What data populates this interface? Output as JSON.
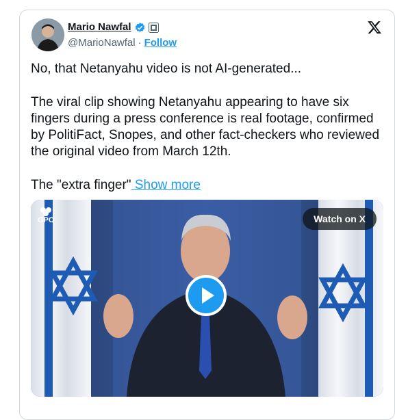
{
  "tweet": {
    "author_name": "Mario Nawfal",
    "author_handle": "@MarioNawfal",
    "separator": "·",
    "follow_label": "Follow",
    "paragraphs": [
      "No, that Netanyahu video is not AI-generated...",
      "The viral clip showing Netanyahu appearing to have six fingers during a press conference is real footage, confirmed by PolitiFact, Snopes, and other fact-checkers who reviewed the original video from March 12th."
    ],
    "truncated_text": "The \"extra finger\"",
    "show_more_label": " Show more"
  },
  "media": {
    "watch_label": "Watch on X",
    "watermark": "GPO"
  },
  "colors": {
    "accent": "#1d9bf0",
    "text": "#0f1419",
    "secondary": "#536471"
  }
}
